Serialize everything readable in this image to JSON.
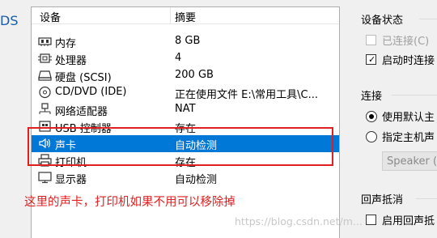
{
  "window": {
    "left_cut_text": "DS"
  },
  "device_list": {
    "headers": {
      "device": "设备",
      "summary": "摘要"
    },
    "rows": [
      {
        "name": "内存",
        "value": "8 GB",
        "icon": "memory-icon"
      },
      {
        "name": "处理器",
        "value": "4",
        "icon": "cpu-icon"
      },
      {
        "name": "硬盘 (SCSI)",
        "value": "200 GB",
        "icon": "harddisk-icon"
      },
      {
        "name": "CD/DVD (IDE)",
        "value": "正在使用文件 E:\\常用工具\\C...",
        "icon": "cd-dvd-icon"
      },
      {
        "name": "网络适配器",
        "value": "NAT",
        "icon": "network-adapter-icon"
      },
      {
        "name": "USB 控制器",
        "value": "存在",
        "icon": "usb-icon"
      },
      {
        "name": "声卡",
        "value": "自动检测",
        "icon": "speaker-icon",
        "selected": true
      },
      {
        "name": "打印机",
        "value": "存在",
        "icon": "printer-icon"
      },
      {
        "name": "显示器",
        "value": "自动检测",
        "icon": "monitor-icon"
      }
    ]
  },
  "annotation": {
    "note": "这里的声卡，打印机如果不用可以移除掉",
    "watermark": "https://blog.csdn.net/m..."
  },
  "device_status": {
    "title": "设备状态",
    "connected_label": "已连接(C)",
    "connected_checked": false,
    "connect_on_start_label": "启动时连接",
    "connect_on_start_checked": true
  },
  "connection": {
    "title": "连接",
    "use_default_label": "使用默认主",
    "use_default_selected": true,
    "specify_host_label": "指定主机声",
    "specify_host_selected": false,
    "device_select_value": "Speaker ("
  },
  "echo_cancel": {
    "title": "回声抵消",
    "enable_label": "启用回声抵",
    "enable_checked": false
  },
  "colors": {
    "selection": "#0078d7",
    "annotation": "#e02020"
  }
}
